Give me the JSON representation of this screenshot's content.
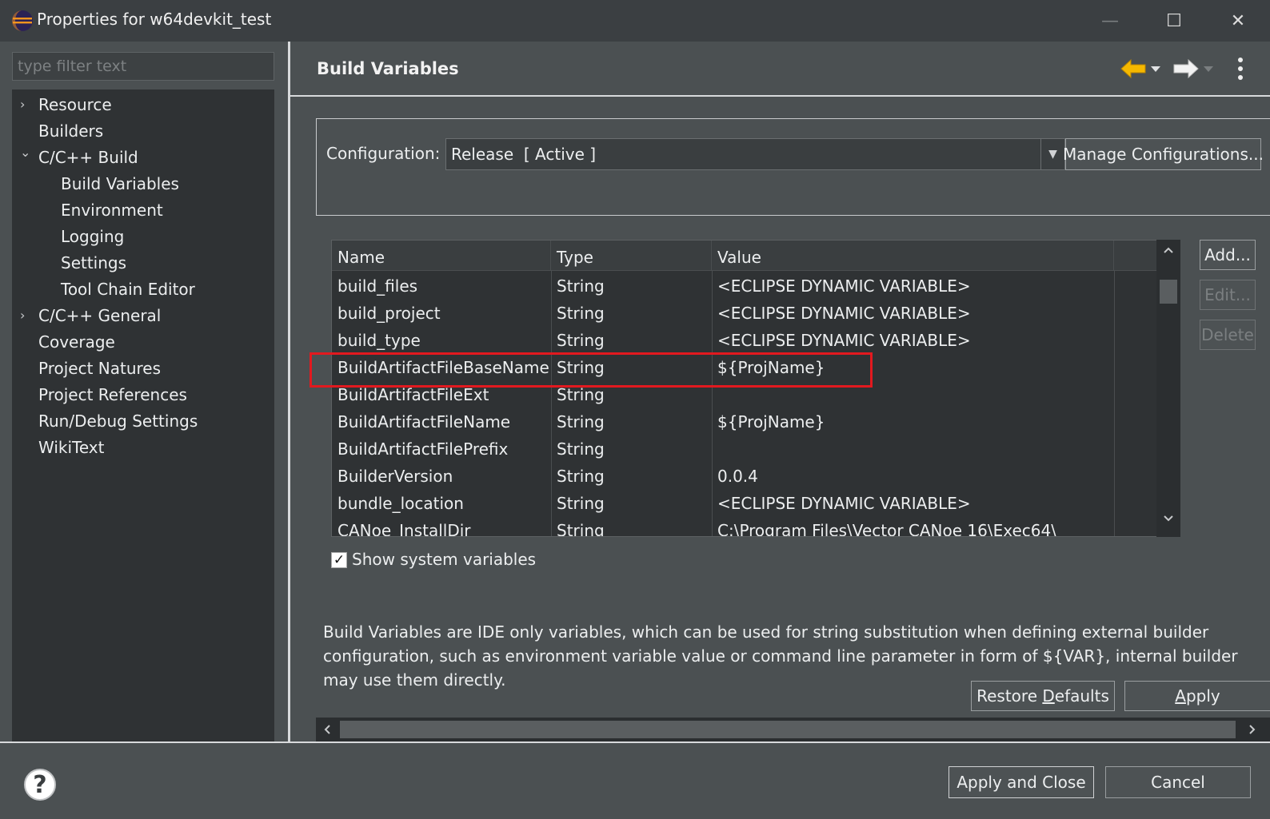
{
  "window": {
    "title": "Properties for w64devkit_test",
    "minimize": "—",
    "maximize": "☐",
    "close": "✕"
  },
  "filter": {
    "placeholder": "type filter text"
  },
  "tree": {
    "items": [
      {
        "label": "Resource",
        "arrow": "›"
      },
      {
        "label": "Builders",
        "arrow": ""
      },
      {
        "label": "C/C++ Build",
        "arrow": "⌄"
      },
      {
        "label": "Build Variables",
        "arrow": ""
      },
      {
        "label": "Environment",
        "arrow": ""
      },
      {
        "label": "Logging",
        "arrow": ""
      },
      {
        "label": "Settings",
        "arrow": ""
      },
      {
        "label": "Tool Chain Editor",
        "arrow": ""
      },
      {
        "label": "C/C++ General",
        "arrow": "›"
      },
      {
        "label": "Coverage",
        "arrow": ""
      },
      {
        "label": "Project Natures",
        "arrow": ""
      },
      {
        "label": "Project References",
        "arrow": ""
      },
      {
        "label": "Run/Debug Settings",
        "arrow": ""
      },
      {
        "label": "WikiText",
        "arrow": ""
      }
    ]
  },
  "page": {
    "title": "Build Variables"
  },
  "config": {
    "label": "Configuration:",
    "selected": "Release  [ Active ]",
    "manage_button": "Manage Configurations..."
  },
  "table": {
    "columns": [
      "Name",
      "Type",
      "Value"
    ],
    "rows": [
      {
        "name": "build_files",
        "type": "String",
        "value": "<ECLIPSE DYNAMIC VARIABLE>"
      },
      {
        "name": "build_project",
        "type": "String",
        "value": "<ECLIPSE DYNAMIC VARIABLE>"
      },
      {
        "name": "build_type",
        "type": "String",
        "value": "<ECLIPSE DYNAMIC VARIABLE>"
      },
      {
        "name": "BuildArtifactFileBaseName",
        "type": "String",
        "value": "${ProjName}"
      },
      {
        "name": "BuildArtifactFileExt",
        "type": "String",
        "value": ""
      },
      {
        "name": "BuildArtifactFileName",
        "type": "String",
        "value": "${ProjName}"
      },
      {
        "name": "BuildArtifactFilePrefix",
        "type": "String",
        "value": ""
      },
      {
        "name": "BuilderVersion",
        "type": "String",
        "value": "0.0.4"
      },
      {
        "name": "bundle_location",
        "type": "String",
        "value": "<ECLIPSE DYNAMIC VARIABLE>"
      },
      {
        "name": "CANoe_InstallDir",
        "type": "String",
        "value": "C:\\Program Files\\Vector CANoe 16\\Exec64\\"
      }
    ]
  },
  "side_buttons": {
    "add": "Add...",
    "edit": "Edit...",
    "delete": "Delete"
  },
  "show_system": {
    "label": "Show system variables",
    "checked": true,
    "check_glyph": "✓"
  },
  "description": "Build Variables are IDE only variables, which can be used for string substitution when defining external builder configuration, such as environment variable value or command line parameter in form of ${VAR}, internal builder may use them directly.",
  "page_buttons": {
    "restore_prefix": "Restore ",
    "restore_underlined": "D",
    "restore_suffix": "efaults",
    "apply_underlined": "A",
    "apply_suffix": "pply"
  },
  "footer": {
    "help": "?",
    "apply_close": "Apply and Close",
    "cancel": "Cancel"
  },
  "colors": {
    "highlight": "#e2191f",
    "background": "#4b5052",
    "tree_bg": "#2f3234",
    "nav_back": "#f5b800"
  },
  "icons": [
    "eclipse-icon",
    "back-arrow-icon",
    "forward-arrow-icon",
    "view-menu-icon",
    "scroll-up-icon",
    "scroll-down-icon",
    "scroll-left-icon",
    "scroll-right-icon",
    "help-icon"
  ]
}
